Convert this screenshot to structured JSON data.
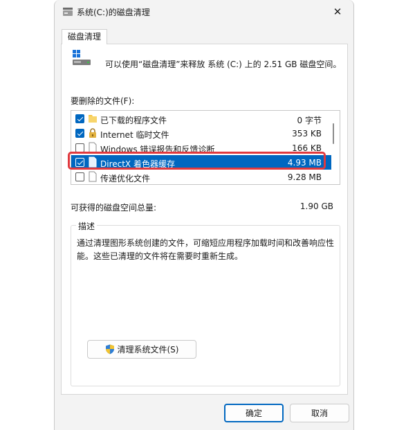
{
  "window": {
    "title": "系统(C:)的磁盘清理",
    "close_glyph": "✕"
  },
  "tab": {
    "label": "磁盘清理"
  },
  "summary": "可以使用“磁盘清理”来释放 系统 (C:) 上的 2.51 GB 磁盘空间。",
  "files_label": "要删除的文件(F):",
  "files": [
    {
      "name": "已下载的程序文件",
      "size": "0 字节",
      "checked": true,
      "icon": "folder-icon"
    },
    {
      "name": "Internet 临时文件",
      "size": "353 KB",
      "checked": true,
      "icon": "lock-icon"
    },
    {
      "name": "Windows 错误报告和反馈诊断",
      "size": "166 KB",
      "checked": false,
      "icon": "file-icon"
    },
    {
      "name": "DirectX 着色器缓存",
      "size": "4.93 MB",
      "checked": true,
      "icon": "file-icon",
      "selected": true
    },
    {
      "name": "传递优化文件",
      "size": "9.28 MB",
      "checked": false,
      "icon": "file-icon"
    }
  ],
  "available": {
    "label": "可获得的磁盘空间总量:",
    "value": "1.90 GB"
  },
  "description": {
    "legend": "描述",
    "text": "通过清理图形系统创建的文件，可缩短应用程序加载时间和改善响应性能。这些已清理的文件将在需要时重新生成。"
  },
  "clean_system_button": "清理系统文件(S)",
  "buttons": {
    "ok": "确定",
    "cancel": "取消"
  },
  "colors": {
    "accent": "#0067c0",
    "highlight": "#e0393e"
  }
}
